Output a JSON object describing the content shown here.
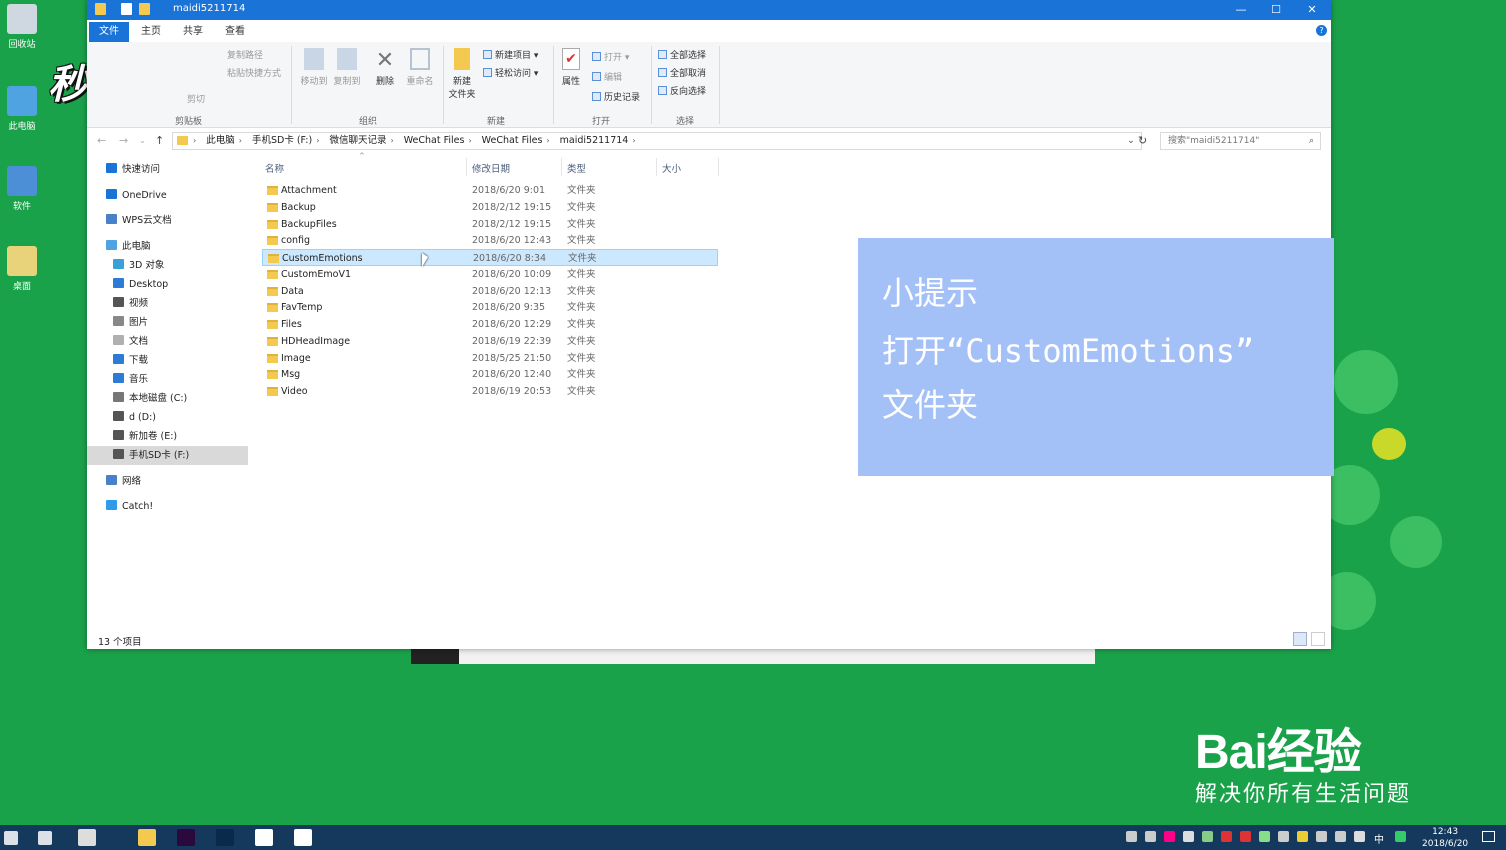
{
  "desktop": {
    "icons": [
      {
        "label": "回收站",
        "color": "#cfd8e0"
      },
      {
        "label": "此电脑",
        "color": "#4fa3e0"
      },
      {
        "label": "软件",
        "color": "#4d8fd6"
      },
      {
        "label": "桌面",
        "color": "#e8d27a"
      }
    ],
    "watermark": "秒dong视频"
  },
  "window": {
    "title": "maidi5211714",
    "controls": {
      "minimize": "—",
      "maximize": "☐",
      "close": "✕"
    },
    "tabs": [
      "文件",
      "主页",
      "共享",
      "查看"
    ],
    "ribbon": {
      "clipboard": {
        "label": "剪贴板",
        "items": [
          "复制路径",
          "粘贴快捷方式",
          "剪切"
        ]
      },
      "organize": {
        "label": "组织",
        "move_to": "移动到",
        "copy_to": "复制到",
        "delete": "删除",
        "rename": "重命名"
      },
      "new": {
        "label": "新建",
        "new_item": "新建项目 ▾",
        "easy_access": "轻松访问 ▾",
        "new_folder_1": "新建",
        "new_folder_2": "文件夹"
      },
      "open": {
        "label": "打开",
        "properties": "属性",
        "open": "打开 ▾",
        "edit": "编辑",
        "history": "历史记录"
      },
      "select": {
        "label": "选择",
        "select_all": "全部选择",
        "select_none": "全部取消",
        "invert": "反向选择"
      }
    },
    "address": {
      "crumbs": [
        "此电脑",
        "手机SD卡 (F:)",
        "微信聊天记录",
        "WeChat Files",
        "WeChat Files",
        "maidi5211714"
      ],
      "search_placeholder": "搜索\"maidi5211714\""
    },
    "nav": [
      {
        "label": "快速访问",
        "color": "#1a73d6",
        "indent": 0
      },
      {
        "label": "OneDrive",
        "color": "#1a73d6",
        "indent": 0
      },
      {
        "label": "WPS云文档",
        "color": "#4a7fc9",
        "indent": 0
      },
      {
        "label": "此电脑",
        "color": "#4fa3e0",
        "indent": 0
      },
      {
        "label": "3D 对象",
        "color": "#3aa0d8",
        "indent": 1
      },
      {
        "label": "Desktop",
        "color": "#2d7bd6",
        "indent": 1
      },
      {
        "label": "视频",
        "color": "#555555",
        "indent": 1
      },
      {
        "label": "图片",
        "color": "#888888",
        "indent": 1
      },
      {
        "label": "文档",
        "color": "#b0b0b0",
        "indent": 1
      },
      {
        "label": "下载",
        "color": "#2d7bd6",
        "indent": 1
      },
      {
        "label": "音乐",
        "color": "#2d7bd6",
        "indent": 1
      },
      {
        "label": "本地磁盘 (C:)",
        "color": "#777777",
        "indent": 1
      },
      {
        "label": "d (D:)",
        "color": "#555555",
        "indent": 1
      },
      {
        "label": "新加卷 (E:)",
        "color": "#555555",
        "indent": 1
      },
      {
        "label": "手机SD卡 (F:)",
        "color": "#555555",
        "indent": 1,
        "selected": true
      },
      {
        "label": "网络",
        "color": "#4a7fc9",
        "indent": 0
      },
      {
        "label": "Catch!",
        "color": "#2d9de8",
        "indent": 0
      }
    ],
    "columns": [
      "名称",
      "修改日期",
      "类型",
      "大小"
    ],
    "files": [
      {
        "name": "Attachment",
        "date": "2018/6/20 9:01",
        "type": "文件夹"
      },
      {
        "name": "Backup",
        "date": "2018/2/12 19:15",
        "type": "文件夹"
      },
      {
        "name": "BackupFiles",
        "date": "2018/2/12 19:15",
        "type": "文件夹"
      },
      {
        "name": "config",
        "date": "2018/6/20 12:43",
        "type": "文件夹"
      },
      {
        "name": "CustomEmotions",
        "date": "2018/6/20 8:34",
        "type": "文件夹",
        "selected": true
      },
      {
        "name": "CustomEmoV1",
        "date": "2018/6/20 10:09",
        "type": "文件夹"
      },
      {
        "name": "Data",
        "date": "2018/6/20 12:13",
        "type": "文件夹"
      },
      {
        "name": "FavTemp",
        "date": "2018/6/20 9:35",
        "type": "文件夹"
      },
      {
        "name": "Files",
        "date": "2018/6/20 12:29",
        "type": "文件夹"
      },
      {
        "name": "HDHeadImage",
        "date": "2018/6/19 22:39",
        "type": "文件夹"
      },
      {
        "name": "Image",
        "date": "2018/5/25 21:50",
        "type": "文件夹"
      },
      {
        "name": "Msg",
        "date": "2018/6/20 12:40",
        "type": "文件夹"
      },
      {
        "name": "Video",
        "date": "2018/6/19 20:53",
        "type": "文件夹"
      }
    ],
    "status": "13 个项目"
  },
  "tip": {
    "line1": "小提示",
    "line2": "打开“CustomEmotions”",
    "line3": "文件夹"
  },
  "baidu": {
    "logo": "Bai经验",
    "slogan": "解决你所有生活问题"
  },
  "taskbar": {
    "apps": [
      {
        "name": "start",
        "color": "#ffffff"
      },
      {
        "name": "task-view",
        "color": "#ffffff"
      },
      {
        "name": "baidu-app",
        "color": "#dddddd"
      },
      {
        "name": "file-explorer",
        "color": "#f3c94f"
      },
      {
        "name": "premiere",
        "color": "#2a0a3d"
      },
      {
        "name": "photoshop",
        "color": "#0a2a4a"
      },
      {
        "name": "obs",
        "color": "#ffffff"
      },
      {
        "name": "wechat",
        "color": "#ffffff"
      }
    ],
    "ime": "中",
    "time": "12:43",
    "date": "2018/6/20"
  },
  "colors": {
    "accent": "#1a73d6",
    "desktop": "#1aa24a",
    "selection": "#cce8ff",
    "tip": "#a4c1f7"
  }
}
